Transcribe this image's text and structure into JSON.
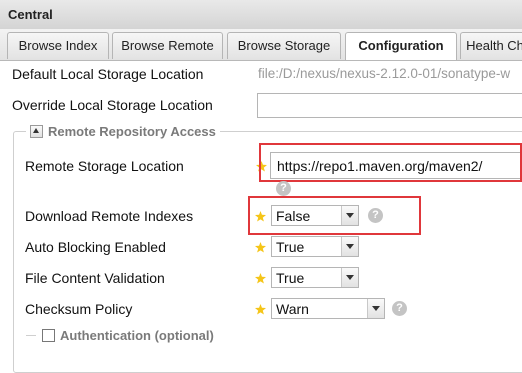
{
  "panel": {
    "title": "Central"
  },
  "tabs": [
    {
      "label": "Browse Index",
      "active": false
    },
    {
      "label": "Browse Remote",
      "active": false
    },
    {
      "label": "Browse Storage",
      "active": false
    },
    {
      "label": "Configuration",
      "active": true
    },
    {
      "label": "Health Ch",
      "active": false
    }
  ],
  "form": {
    "default_storage": {
      "label": "Default Local Storage Location",
      "value": "file:/D:/nexus/nexus-2.12.0-01/sonatype-w"
    },
    "override_storage": {
      "label": "Override Local Storage Location",
      "value": ""
    },
    "remote_section": {
      "legend": "Remote Repository Access",
      "remote_storage": {
        "label": "Remote Storage Location",
        "value": "https://repo1.maven.org/maven2/"
      },
      "download_indexes": {
        "label": "Download Remote Indexes",
        "value": "False"
      },
      "auto_blocking": {
        "label": "Auto Blocking Enabled",
        "value": "True"
      },
      "file_validation": {
        "label": "File Content Validation",
        "value": "True"
      },
      "checksum_policy": {
        "label": "Checksum Policy",
        "value": "Warn"
      }
    },
    "auth_section": {
      "legend": "Authentication (optional)"
    }
  },
  "help_glyph": "?",
  "colors": {
    "highlight": "#e0373b",
    "required_star": "#f5c518"
  }
}
